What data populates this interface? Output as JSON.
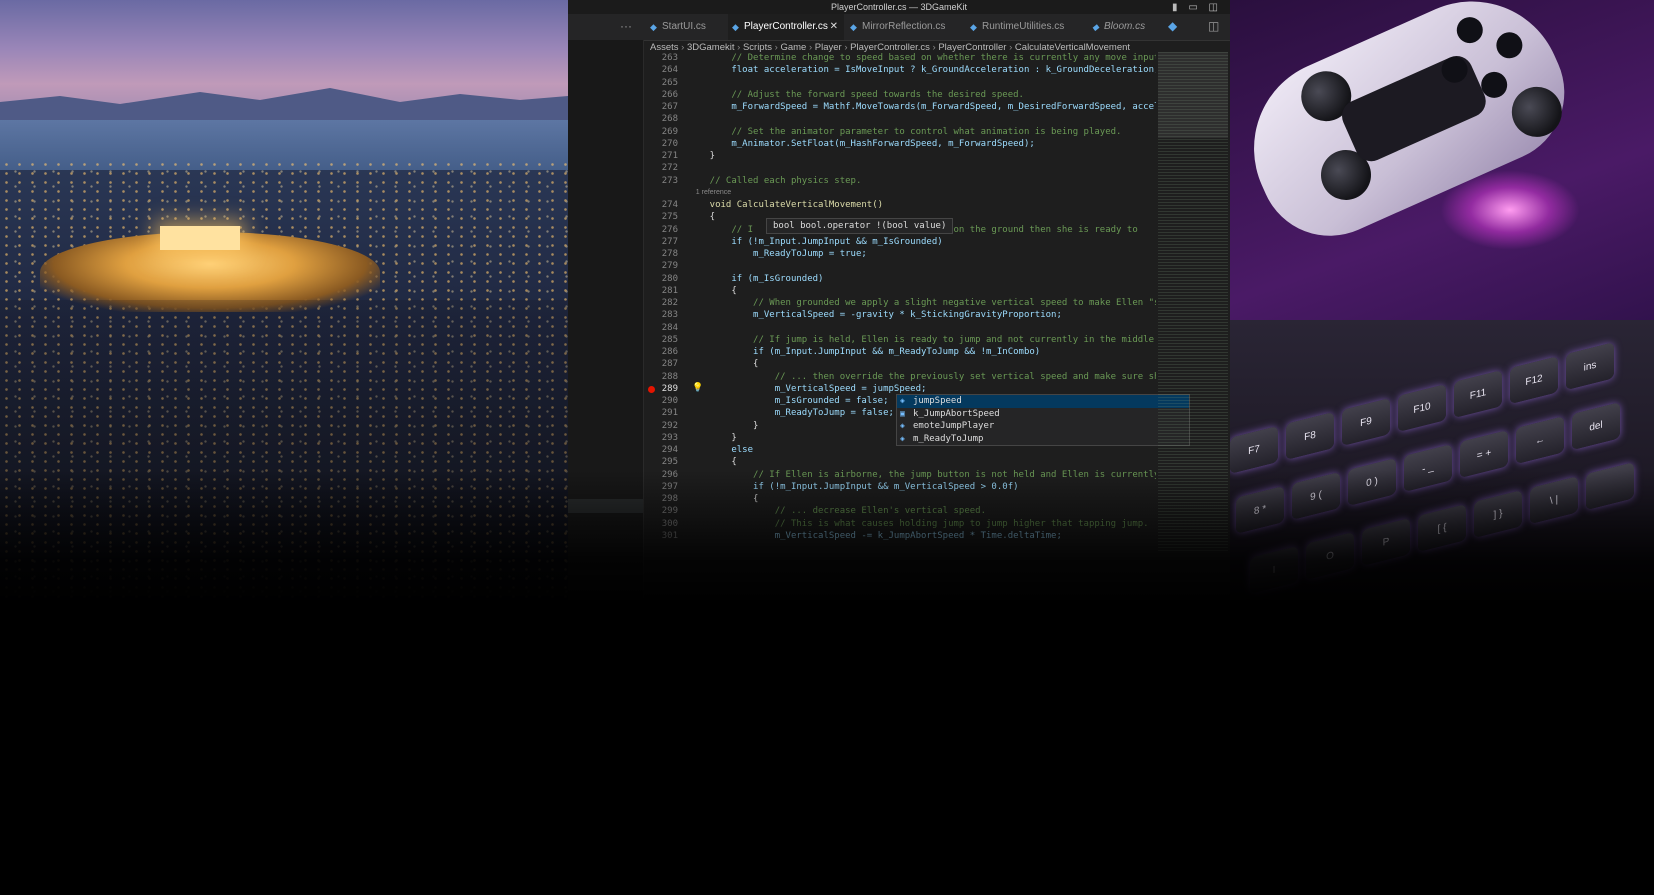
{
  "window": {
    "title": "PlayerController.cs — 3DGameKit"
  },
  "tabs": [
    {
      "label": "StartUI.cs",
      "active": false
    },
    {
      "label": "PlayerController.cs",
      "active": true
    },
    {
      "label": "MirrorReflection.cs",
      "active": false
    },
    {
      "label": "RuntimeUtilities.cs",
      "active": false
    },
    {
      "label": "Bloom.cs",
      "active": false
    }
  ],
  "breadcrumb": [
    "Assets",
    "3DGamekit",
    "Scripts",
    "Game",
    "Player",
    "PlayerController.cs",
    "PlayerController",
    "CalculateVerticalMovement"
  ],
  "code": {
    "lines": [
      {
        "n": "263",
        "t": "        // Determine change to speed based on whether there is currently any move input."
      },
      {
        "n": "264",
        "t": "        float acceleration = IsMoveInput ? k_GroundAcceleration : k_GroundDeceleration;"
      },
      {
        "n": "265",
        "t": ""
      },
      {
        "n": "266",
        "t": "        // Adjust the forward speed towards the desired speed."
      },
      {
        "n": "267",
        "t": "        m_ForwardSpeed = Mathf.MoveTowards(m_ForwardSpeed, m_DesiredForwardSpeed, acceler"
      },
      {
        "n": "268",
        "t": ""
      },
      {
        "n": "269",
        "t": "        // Set the animator parameter to control what animation is being played."
      },
      {
        "n": "270",
        "t": "        m_Animator.SetFloat(m_HashForwardSpeed, m_ForwardSpeed);"
      },
      {
        "n": "271",
        "t": "    }"
      },
      {
        "n": "272",
        "t": ""
      },
      {
        "n": "273",
        "t": "    // Called each physics step."
      },
      {
        "n": "",
        "t": "    1 reference"
      },
      {
        "n": "274",
        "t": "    void CalculateVerticalMovement()"
      },
      {
        "n": "275",
        "t": "    {"
      },
      {
        "n": "276",
        "t": "        // I                             llen is on the ground then she is ready to"
      },
      {
        "n": "277",
        "t": "        if (!m_Input.JumpInput && m_IsGrounded)"
      },
      {
        "n": "278",
        "t": "            m_ReadyToJump = true;"
      },
      {
        "n": "279",
        "t": ""
      },
      {
        "n": "280",
        "t": "        if (m_IsGrounded)"
      },
      {
        "n": "281",
        "t": "        {"
      },
      {
        "n": "282",
        "t": "            // When grounded we apply a slight negative vertical speed to make Ellen \"sti"
      },
      {
        "n": "283",
        "t": "            m_VerticalSpeed = -gravity * k_StickingGravityProportion;"
      },
      {
        "n": "284",
        "t": ""
      },
      {
        "n": "285",
        "t": "            // If jump is held, Ellen is ready to jump and not currently in the middle of"
      },
      {
        "n": "286",
        "t": "            if (m_Input.JumpInput && m_ReadyToJump && !m_InCombo)"
      },
      {
        "n": "287",
        "t": "            {"
      },
      {
        "n": "288",
        "t": "                // ... then override the previously set vertical speed and make sure she"
      },
      {
        "n": "289",
        "t": "                m_VerticalSpeed = jumpSpeed;"
      },
      {
        "n": "290",
        "t": "                m_IsGrounded = false;"
      },
      {
        "n": "291",
        "t": "                m_ReadyToJump = false;"
      },
      {
        "n": "292",
        "t": "            }"
      },
      {
        "n": "293",
        "t": "        }"
      },
      {
        "n": "294",
        "t": "        else"
      },
      {
        "n": "295",
        "t": "        {"
      },
      {
        "n": "296",
        "t": "            // If Ellen is airborne, the jump button is not held and Ellen is currently m"
      },
      {
        "n": "297",
        "t": "            if (!m_Input.JumpInput && m_VerticalSpeed > 0.0f)"
      },
      {
        "n": "298",
        "t": "            {"
      },
      {
        "n": "299",
        "t": "                // ... decrease Ellen's vertical speed."
      },
      {
        "n": "300",
        "t": "                // This is what causes holding jump to jump higher that tapping jump."
      },
      {
        "n": "301",
        "t": "                m_VerticalSpeed -= k_JumpAbortSpeed * Time.deltaTime;"
      }
    ],
    "styles": [
      "c",
      "k",
      "",
      "c",
      "k",
      "",
      "c",
      "k",
      "",
      "",
      "c",
      "ref",
      "fn",
      "",
      "c",
      "k",
      "k",
      "",
      "k",
      "",
      "c",
      "k",
      "",
      "c",
      "k",
      "",
      "c",
      "k",
      "k",
      "k",
      "",
      "",
      "k",
      "",
      "c",
      "k",
      "",
      "c",
      "c",
      "k"
    ]
  },
  "tooltip": {
    "text": "bool bool.operator !(bool value)"
  },
  "suggestions": [
    {
      "label": "jumpSpeed",
      "icon": "variable-icon",
      "selected": true
    },
    {
      "label": "k_JumpAbortSpeed",
      "icon": "constant-icon",
      "selected": false
    },
    {
      "label": "emoteJumpPlayer",
      "icon": "variable-icon",
      "selected": false
    },
    {
      "label": "m_ReadyToJump",
      "icon": "variable-icon",
      "selected": false
    }
  ],
  "keyboard": {
    "row1": [
      "F7",
      "F8",
      "F9",
      "F10",
      "F11",
      "F12",
      "ins"
    ],
    "row2": [
      "8 *",
      "9 (",
      "0 )",
      "- _",
      "= +",
      "←",
      "del"
    ],
    "row3": [
      "I",
      "O",
      "P",
      "[ {",
      "] }",
      "\\ |",
      ""
    ]
  },
  "colors": {
    "accent": "#5aa5e6",
    "breakpoint": "#e51400",
    "comment": "#6a9955"
  }
}
